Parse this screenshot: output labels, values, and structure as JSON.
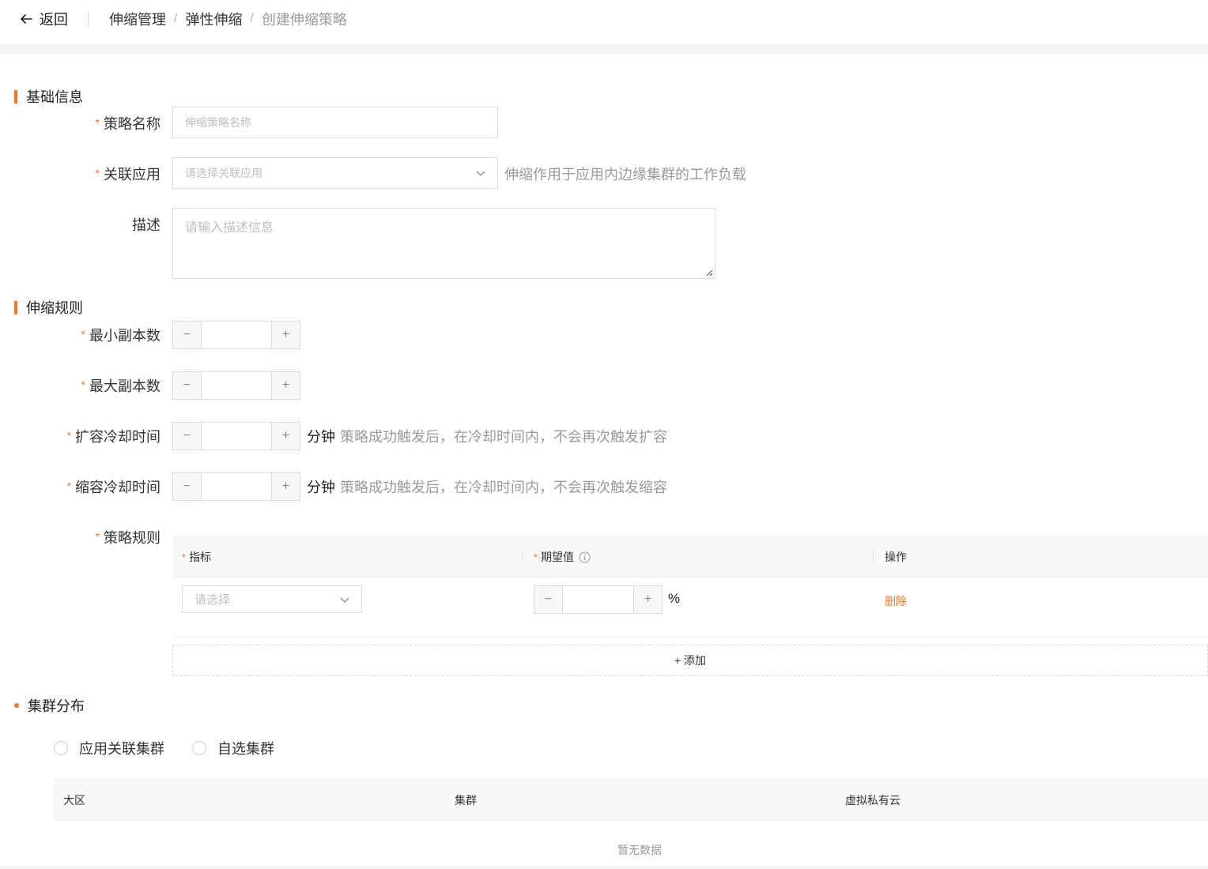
{
  "header": {
    "back_label": "返回",
    "breadcrumb": [
      "伸缩管理",
      "弹性伸缩",
      "创建伸缩策略"
    ],
    "separator": "/"
  },
  "sections": {
    "basic": "基础信息",
    "rules": "伸缩规则",
    "clusters": "集群分布"
  },
  "form": {
    "required_mark": "*",
    "name": {
      "label": "策略名称",
      "placeholder": "伸缩策略名称"
    },
    "app": {
      "label": "关联应用",
      "placeholder": "请选择关联应用",
      "hint": "伸缩作用于应用内边缘集群的工作负载"
    },
    "desc": {
      "label": "描述",
      "placeholder": "请输入描述信息"
    },
    "min_replicas": {
      "label": "最小副本数"
    },
    "max_replicas": {
      "label": "最大副本数"
    },
    "scale_up_cooldown": {
      "label": "扩容冷却时间",
      "unit": "分钟",
      "hint": "策略成功触发后，在冷却时间内，不会再次触发扩容"
    },
    "scale_down_cooldown": {
      "label": "缩容冷却时间",
      "unit": "分钟",
      "hint": "策略成功触发后，在冷却时间内，不会再次触发缩容"
    },
    "stepper": {
      "minus": "−",
      "plus": "+"
    },
    "policy_rules": {
      "label": "策略规则",
      "columns": {
        "metric": "指标",
        "expected": "期望值",
        "action": "操作"
      },
      "row": {
        "metric_placeholder": "请选择",
        "unit": "%",
        "delete": "删除"
      },
      "add_label": "+ 添加"
    }
  },
  "cluster": {
    "options": [
      "应用关联集群",
      "自选集群"
    ],
    "columns": [
      "大区",
      "集群",
      "虚拟私有云"
    ],
    "empty": "暂无数据"
  },
  "colors": {
    "accent": "#f5762a",
    "header_bg": "#f7f8f8"
  }
}
